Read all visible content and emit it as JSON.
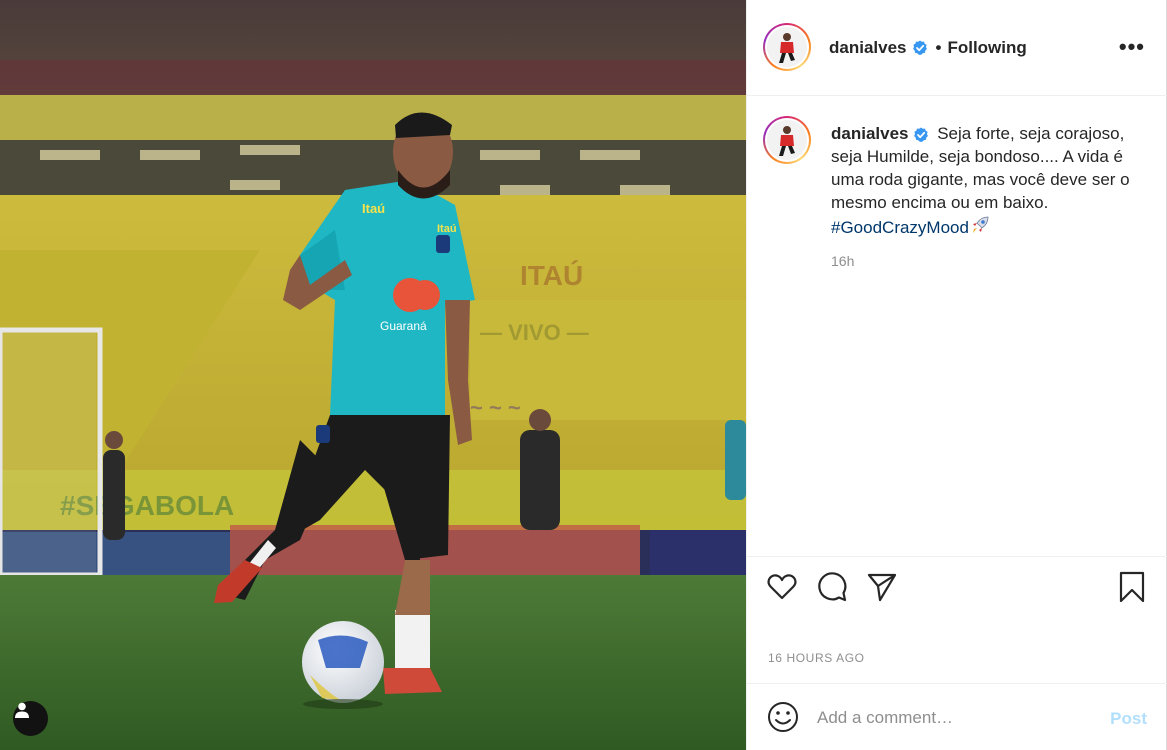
{
  "photo": {
    "alt_subject": "soccer player in training kit kicking ball on stadium pitch",
    "tag_icon": "user-tag-icon"
  },
  "header": {
    "username": "danialves",
    "separator": "•",
    "following_label": "Following",
    "more_icon": "more-options-icon",
    "more_label": "•••"
  },
  "caption": {
    "username": "danialves",
    "text": "Seja forte, seja corajoso, seja Humilde, seja bondoso.... A vida é uma roda gigante, mas você deve ser o mesmo encima ou em baixo.",
    "hashtag": "#GoodCrazyMood",
    "time": "16h"
  },
  "actions": {
    "like_icon": "heart-icon",
    "comment_icon": "comment-icon",
    "share_icon": "send-icon",
    "save_icon": "bookmark-icon"
  },
  "timestamp": "16 HOURS AGO",
  "comment_bar": {
    "emoji_icon": "emoji-icon",
    "placeholder": "Add a comment…",
    "post_label": "Post"
  },
  "colors": {
    "verified_blue": "#3897f0",
    "hashtag_blue": "#00376b",
    "post_button_disabled": "#b2dffc",
    "muted_text": "#8e8e8e"
  }
}
